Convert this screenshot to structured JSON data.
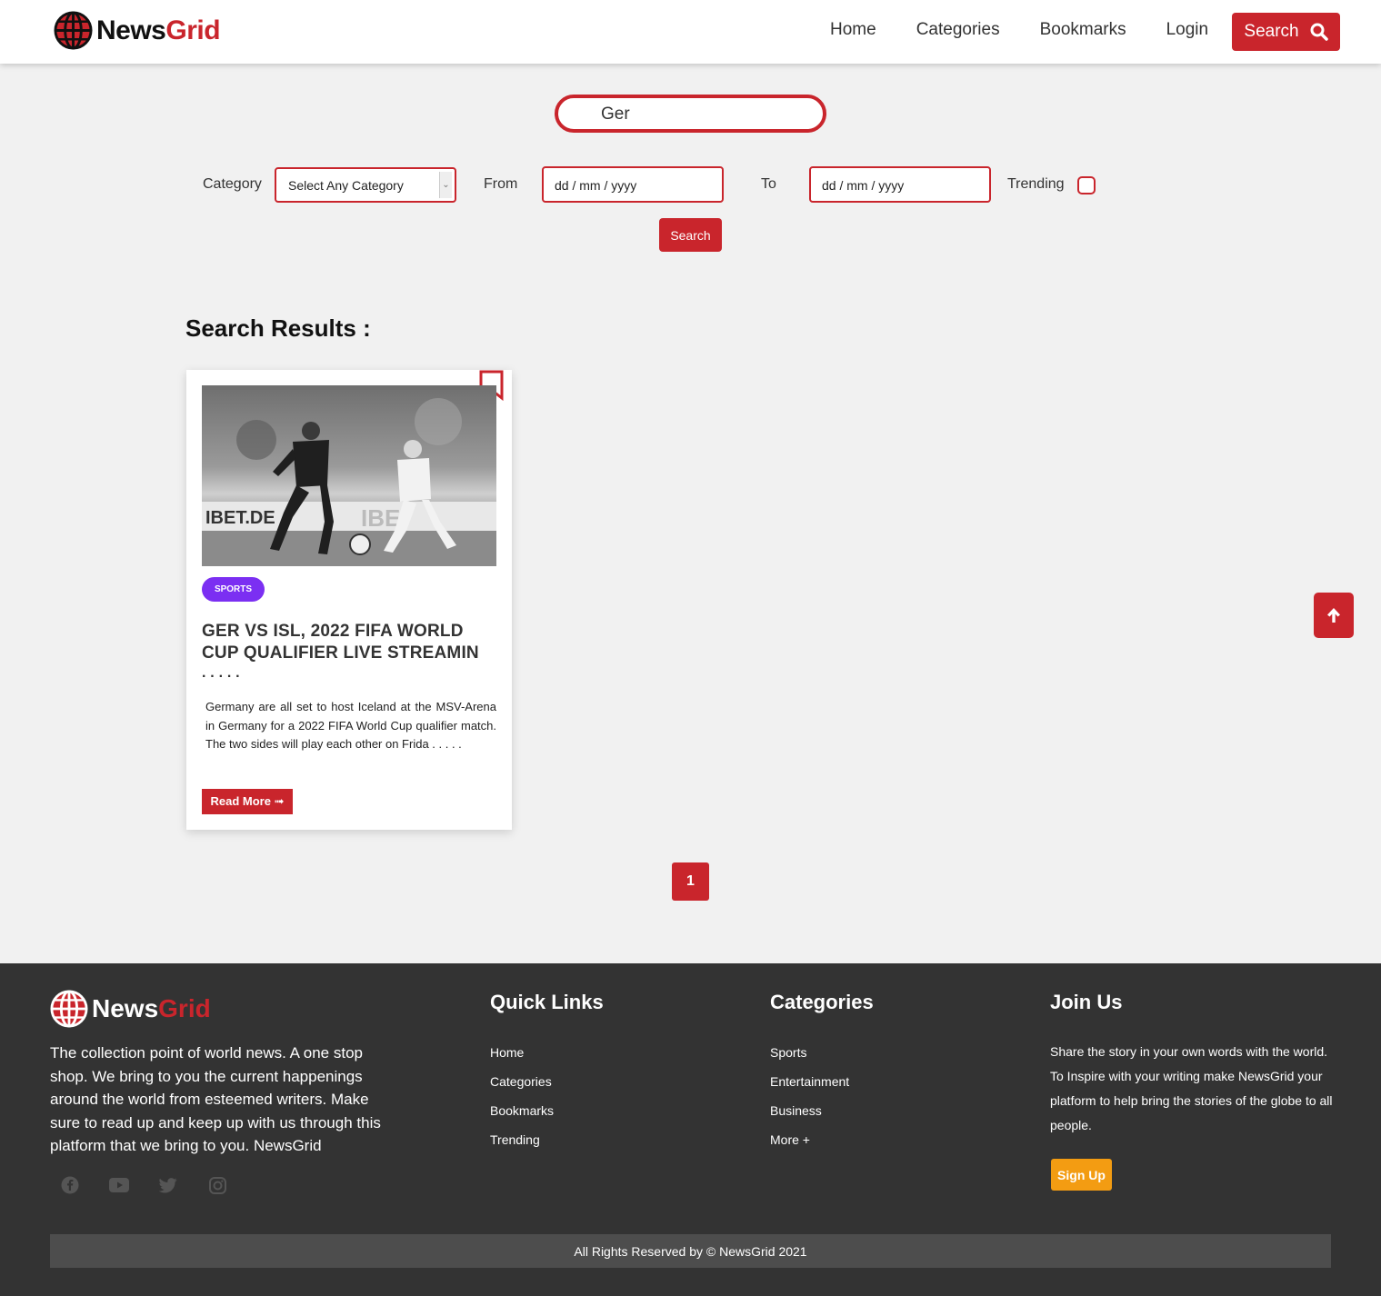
{
  "brand": {
    "part1": "News",
    "part2": "Grid"
  },
  "nav": {
    "links": [
      "Home",
      "Categories",
      "Bookmarks",
      "Login"
    ],
    "search_label": "Search"
  },
  "search": {
    "value": "Ger"
  },
  "filters": {
    "category_label": "Category",
    "category_selected": "Select Any Category",
    "from_label": "From",
    "from_value": "dd / mm / yyyy",
    "to_label": "To",
    "to_value": "dd / mm / yyyy",
    "trending_label": "Trending",
    "trending_checked": false,
    "button_label": "Search"
  },
  "results": {
    "title": "Search Results :",
    "cards": [
      {
        "category": "SPORTS",
        "title": "GER VS ISL, 2022 FIFA WORLD CUP QUALIFIER LIVE STREAMIN",
        "title_dots": ". . . . .",
        "excerpt": "Germany are all set to host Iceland at the MSV-Arena in Germany for a 2022 FIFA World Cup qualifier match. The two sides will play each other on Frida . . . . .",
        "read_more": "Read More ➟"
      }
    ]
  },
  "pagination": {
    "current": "1"
  },
  "footer": {
    "about": "The collection point of world news. A one stop shop. We bring to you the current happenings around the world from esteemed writers. Make sure to read up and keep up with us through this platform that we bring to you. NewsGrid",
    "quick_links_title": "Quick Links",
    "quick_links": [
      "Home",
      "Categories",
      "Bookmarks",
      "Trending"
    ],
    "categories_title": "Categories",
    "categories": [
      "Sports",
      "Entertainment",
      "Business",
      "More +"
    ],
    "join_title": "Join Us",
    "join_text": "Share the story in your own words with the world. To Inspire with your writing make NewsGrid your platform to help bring the stories of the globe to all people.",
    "signup_label": "Sign Up",
    "social_icons": [
      "facebook-icon",
      "youtube-icon",
      "twitter-icon",
      "instagram-icon"
    ],
    "copyright": "All Rights Reserved by © NewsGrid 2021"
  },
  "colors": {
    "accent": "#c9252c",
    "badge": "#7b2ff2",
    "footer_bg": "#333333",
    "signup": "#f39c12"
  }
}
